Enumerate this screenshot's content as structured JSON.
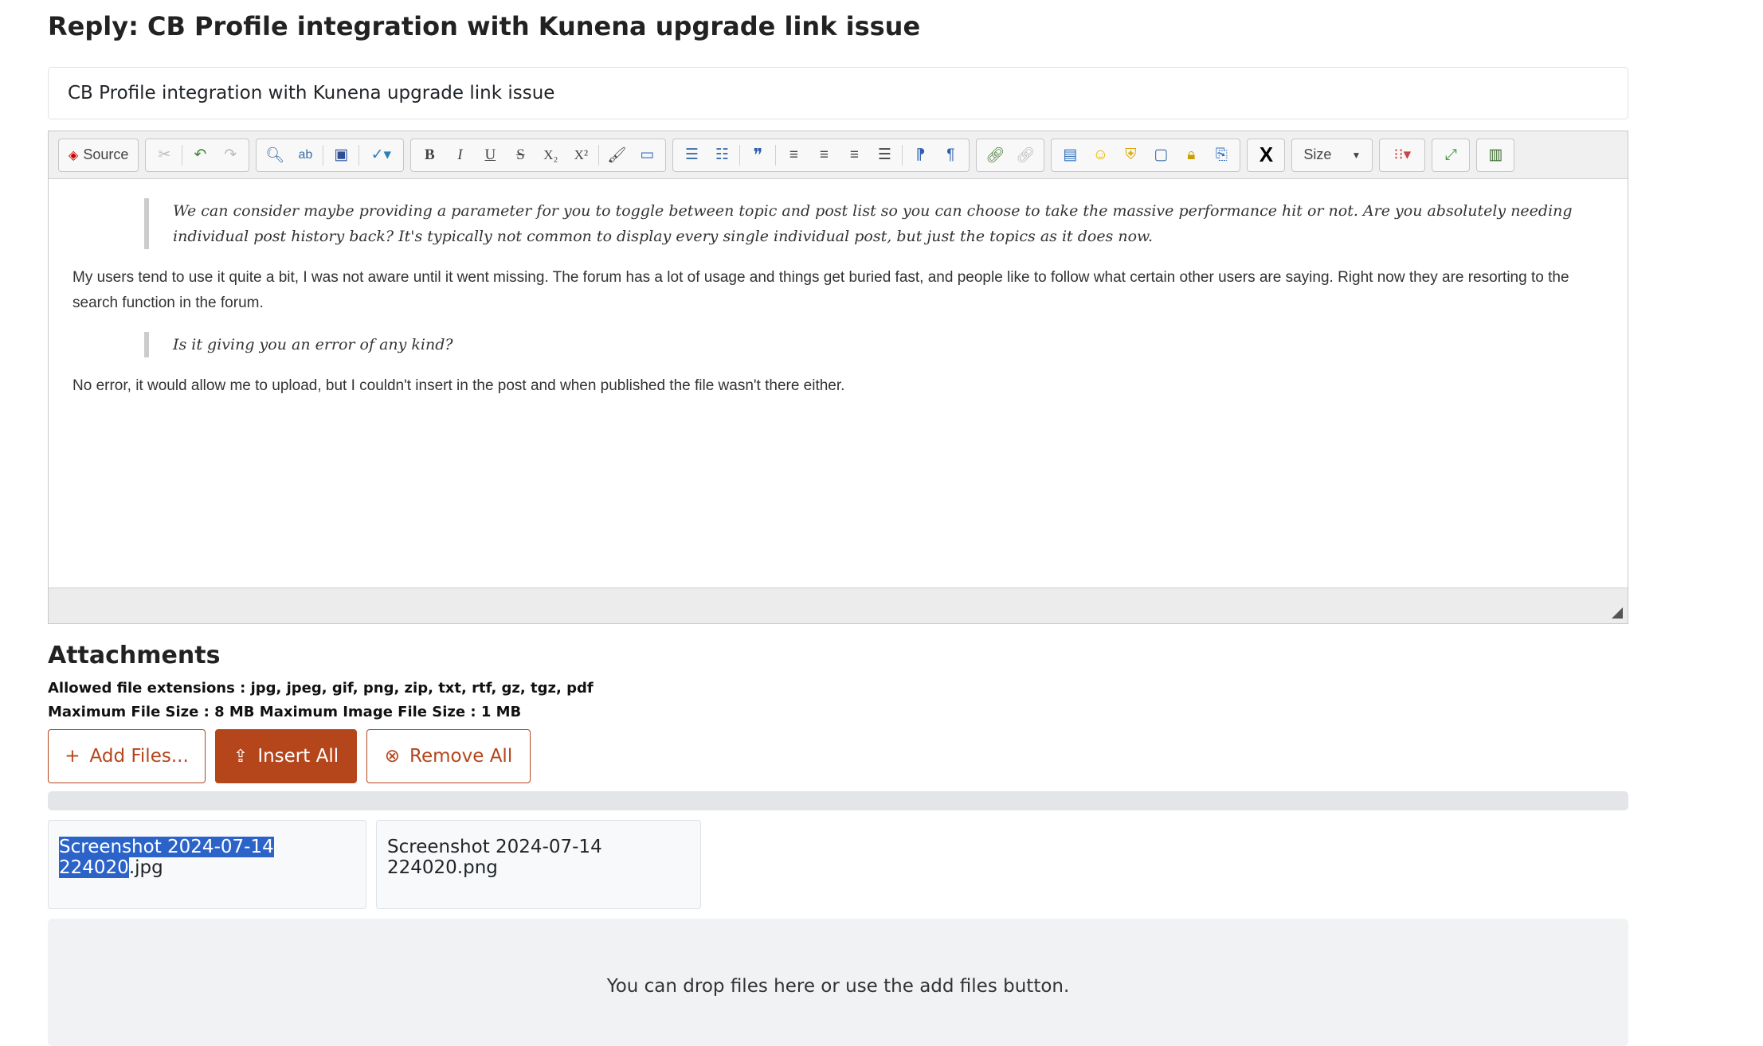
{
  "page": {
    "title": "Reply: CB Profile integration with Kunena upgrade link issue"
  },
  "subject": {
    "value": "CB Profile integration with Kunena upgrade link issue"
  },
  "toolbar": {
    "source_label": "Source",
    "size_label": "Size",
    "bold": "B",
    "italic": "I",
    "underline": "U",
    "strike": "S",
    "subscript": "X₂",
    "superscript": "X²",
    "quote": "❞",
    "x_logo": "X"
  },
  "editor": {
    "quote1": "We can consider maybe providing a parameter for you to toggle between topic and post list so you can choose to take the massive performance hit or not. Are you absolutely needing individual post history back? It's typically not common to display every single individual post, but just the topics as it does now.",
    "para1": "My users tend to use it quite a bit, I was not aware until it went missing. The forum has a lot of usage and things get buried fast, and people like to follow what certain other users are saying. Right now they are resorting to the search function in the forum.",
    "quote2": "Is it giving you an error of any kind?",
    "para2": "No error, it would allow me to upload, but I couldn't insert in the post and when published the file wasn't there either."
  },
  "attachments": {
    "heading": "Attachments",
    "allowed": "Allowed file extensions : jpg, jpeg, gif, png, zip, txt, rtf, gz, tgz, pdf",
    "max_size": "Maximum File Size : 8 MB Maximum Image File Size : 1 MB",
    "add_files": "Add Files...",
    "insert_all": "Insert All",
    "remove_all": "Remove All",
    "progress": 0,
    "files": [
      {
        "name_selected": "Screenshot 2024-07-14 224020",
        "name_rest": ".jpg"
      },
      {
        "name": "Screenshot 2024-07-14 224020.png"
      }
    ],
    "drop_hint": "You can drop files here or use the add files button."
  },
  "colors": {
    "accent": "#b5451b",
    "selection": "#2b63c9"
  }
}
